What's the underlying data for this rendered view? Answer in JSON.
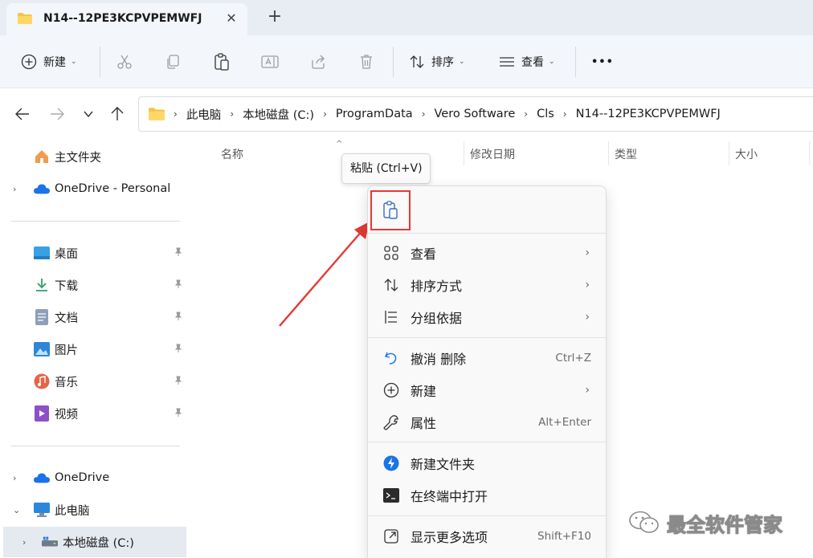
{
  "window": {
    "tab_title": "N14--12PE3KCPVPEMWFJ",
    "close_glyph": "✕",
    "new_tab_glyph": "+"
  },
  "toolbar": {
    "new_label": "新建",
    "sort_label": "排序",
    "view_label": "查看",
    "more_glyph": "•••",
    "caret": "⌄"
  },
  "address": {
    "crumbs": [
      "此电脑",
      "本地磁盘 (C:)",
      "ProgramData",
      "Vero Software",
      "Cls",
      "N14--12PE3KCPVPEMWFJ"
    ],
    "sep": "›"
  },
  "sidebar": {
    "home": "主文件夹",
    "onedrive_personal": "OneDrive - Personal",
    "desktop": "桌面",
    "downloads": "下载",
    "documents": "文档",
    "pictures": "图片",
    "music": "音乐",
    "videos": "视频",
    "onedrive": "OneDrive",
    "this_pc": "此电脑",
    "local_disk": "本地磁盘 (C:)",
    "expand_glyph": "›",
    "expanded_glyph": "⌄",
    "pin_glyph": "📌"
  },
  "columns": {
    "name": "名称",
    "modified": "修改日期",
    "type": "类型",
    "size": "大小",
    "sort_glyph": "^"
  },
  "tooltip": {
    "text": "粘贴 (Ctrl+V)"
  },
  "context_menu": {
    "view": "查看",
    "sort_by": "排序方式",
    "group_by": "分组依据",
    "undo": "撤消 删除",
    "undo_shortcut": "Ctrl+Z",
    "new": "新建",
    "properties": "属性",
    "properties_shortcut": "Alt+Enter",
    "new_folder": "新建文件夹",
    "open_terminal": "在终端中打开",
    "more_options": "显示更多选项",
    "more_options_shortcut": "Shift+F10",
    "arrow_glyph": "›"
  },
  "watermark": {
    "text": "最全软件管家"
  },
  "colors": {
    "accent": "#0067c0",
    "highlight_red": "#e53935",
    "tab_bar": "#e8ecf3",
    "toolbar": "#f3f6fb"
  }
}
